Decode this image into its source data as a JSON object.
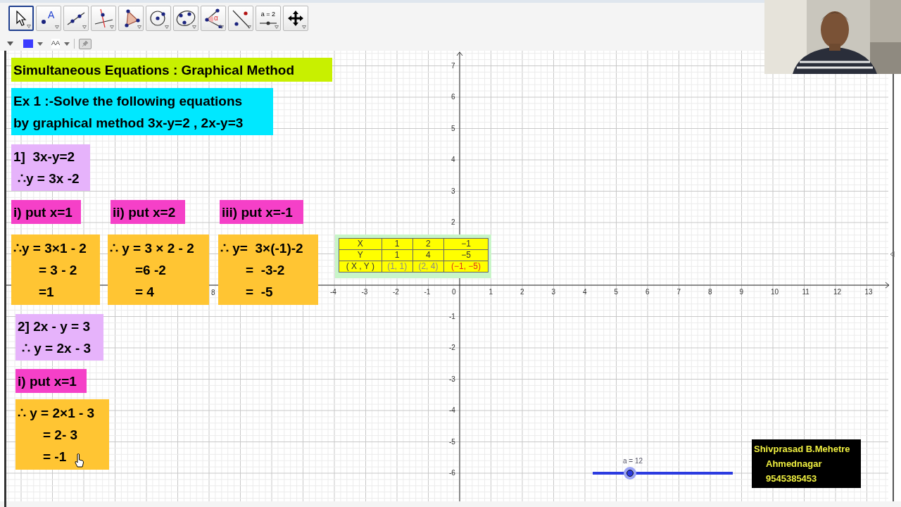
{
  "toolbar": {
    "tools": [
      {
        "kind": "move",
        "selected": true
      },
      {
        "kind": "point",
        "label": "A",
        "selected": false
      },
      {
        "kind": "line",
        "selected": false
      },
      {
        "kind": "perpendicular",
        "selected": false
      },
      {
        "kind": "polygon",
        "selected": false
      },
      {
        "kind": "circle",
        "selected": false
      },
      {
        "kind": "conic",
        "selected": false
      },
      {
        "kind": "angle",
        "label": "α",
        "selected": false
      },
      {
        "kind": "reflect",
        "selected": false
      },
      {
        "kind": "slider",
        "label": "a = 2",
        "selected": false
      },
      {
        "kind": "move_view",
        "selected": false
      }
    ]
  },
  "style_bar": {
    "color": "#3b3bff",
    "text_size": "AA"
  },
  "canvas": {
    "text_boxes": [
      {
        "kind": "heading",
        "color": "#c8f000",
        "lines": [
          "Simultaneous Equations : Graphical Method"
        ]
      },
      {
        "kind": "heading",
        "color": "#00e8ff",
        "lines": [
          "Ex 1 :-Solve the following equations",
          "by graphical method 3x-y=2 , 2x-y=3"
        ]
      },
      {
        "kind": "equation",
        "color": "#e6b3fb",
        "lines": [
          "1]  3x-y=2",
          "∴y = 3x -2"
        ]
      },
      {
        "kind": "step",
        "color": "#f540c8",
        "lines": [
          "i) put x=1"
        ]
      },
      {
        "kind": "step",
        "color": "#f540c8",
        "lines": [
          "ii) put x=2"
        ]
      },
      {
        "kind": "step",
        "color": "#f540c8",
        "lines": [
          "iii) put x=-1"
        ]
      },
      {
        "kind": "solution",
        "color": "#ffc533",
        "lines": [
          "∴y = 3×1 - 2",
          "= 3 - 2",
          "=1"
        ]
      },
      {
        "kind": "solution",
        "color": "#ffc533",
        "lines": [
          "∴ y = 3 × 2 - 2",
          "=6 -2",
          "= 4"
        ]
      },
      {
        "kind": "solution",
        "color": "#ffc533",
        "lines": [
          "∴ y=  3×(-1)-2",
          "=  -3-2",
          "=  -5"
        ]
      },
      {
        "kind": "equation",
        "color": "#e6b3fb",
        "lines": [
          "2] 2x - y = 3",
          "∴ y = 2x - 3"
        ]
      },
      {
        "kind": "step",
        "color": "#f540c8",
        "lines": [
          "i) put x=1"
        ]
      },
      {
        "kind": "solution",
        "color": "#ffc533",
        "lines": [
          "∴ y = 2×1 - 3",
          "= 2- 3",
          "= -1"
        ]
      }
    ],
    "table": {
      "rows": [
        [
          "X",
          "1",
          "2",
          "−1"
        ],
        [
          "Y",
          "1",
          "4",
          "−5"
        ]
      ],
      "points_header": "( X , Y )",
      "points": [
        {
          "text": "(1, 1)",
          "highlighted": false
        },
        {
          "text": "(2, 4)",
          "highlighted": false
        },
        {
          "text": "(−1, −5)",
          "highlighted": true
        }
      ]
    },
    "x_axis": {
      "partial_label": "8",
      "labels": [
        "-4",
        "-3",
        "-2",
        "-1",
        "0",
        "1",
        "2",
        "3",
        "4",
        "5",
        "6",
        "7",
        "8",
        "9",
        "10",
        "11",
        "12",
        "13"
      ]
    },
    "y_axis": {
      "labels_positive": [
        "7",
        "6",
        "5",
        "4",
        "3",
        "2"
      ],
      "labels_negative": [
        "-1",
        "-2",
        "-3",
        "-4",
        "-5",
        "-6"
      ]
    },
    "slider": {
      "label": "a = 12"
    },
    "credit": {
      "lines": [
        "Shivprasad B.Mehetre",
        "Ahmednagar",
        "9545385453"
      ]
    }
  }
}
